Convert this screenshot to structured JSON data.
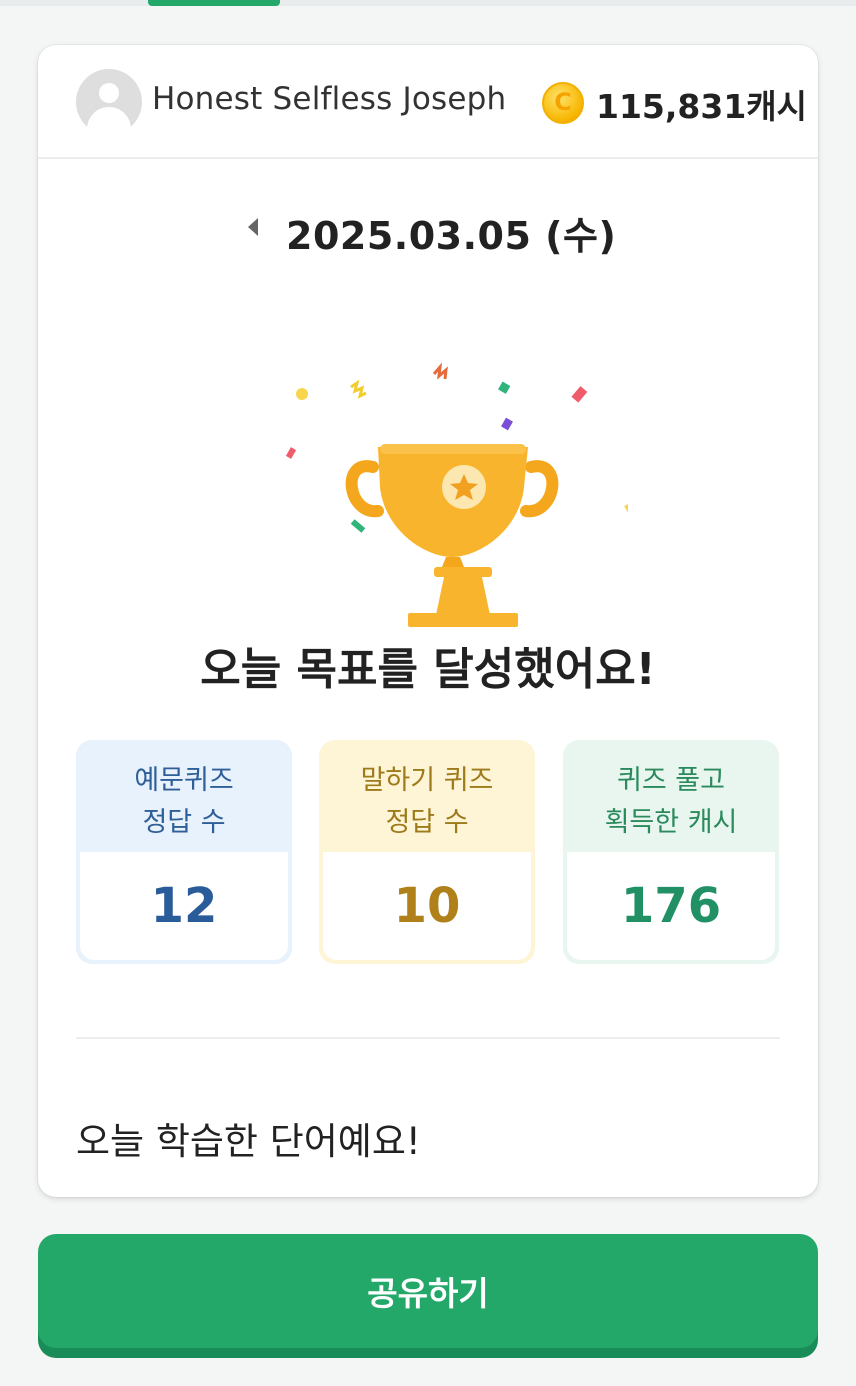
{
  "header": {
    "username": "Honest Selfless Joseph",
    "coin_icon_letter": "C",
    "coin_balance": "115,831캐시",
    "avatar_icon": "user-avatar-icon"
  },
  "date": {
    "text": "2025.03.05 (수)",
    "prev_icon": "triangle-left-icon"
  },
  "goal": {
    "icon": "trophy-icon",
    "title": "오늘 목표를 달성했어요!"
  },
  "stats": [
    {
      "label_line1": "예문퀴즈",
      "label_line2": "정답 수",
      "value": "12",
      "color": "#2a5c9a"
    },
    {
      "label_line1": "말하기 퀴즈",
      "label_line2": "정답 수",
      "value": "10",
      "color": "#b0801a"
    },
    {
      "label_line1": "퀴즈 풀고",
      "label_line2": "획득한 캐시",
      "value": "176",
      "color": "#219165"
    }
  ],
  "learned": {
    "title": "오늘 학습한 단어예요!"
  },
  "share_button": {
    "label": "공유하기",
    "color": "#23a86a"
  }
}
